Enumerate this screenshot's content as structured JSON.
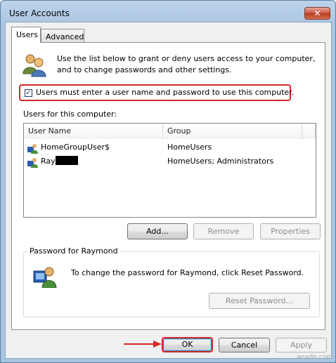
{
  "window": {
    "title": "User Accounts",
    "close_glyph": "✕"
  },
  "tabs": [
    {
      "label": "Users",
      "active": true
    },
    {
      "label": "Advanced",
      "active": false
    }
  ],
  "intro": {
    "text_line1": "Use the list below to grant or deny users access to your computer,",
    "text_line2": "and to change passwords and other settings.",
    "icon": "users-icon"
  },
  "checkbox": {
    "label": "Users must enter a user name and password to use this computer.",
    "checked": true,
    "glyph": "✓",
    "highlight_color": "#d62828"
  },
  "users_list": {
    "label": "Users for this computer:",
    "columns": [
      "User Name",
      "Group"
    ],
    "rows": [
      {
        "name": "HomeGroupUser$",
        "group": "HomeUsers"
      },
      {
        "name": "Ray",
        "group": "HomeUsers; Administrators",
        "redacted": true
      }
    ]
  },
  "buttons": {
    "add": "Add...",
    "remove": "Remove",
    "properties": "Properties",
    "reset_password": "Reset Password...",
    "ok": "OK",
    "cancel": "Cancel",
    "apply": "Apply"
  },
  "password_group": {
    "title": "Password for Raymond",
    "text": "To change the password for Raymond, click Reset Password."
  },
  "watermark": "wsxdn.com"
}
